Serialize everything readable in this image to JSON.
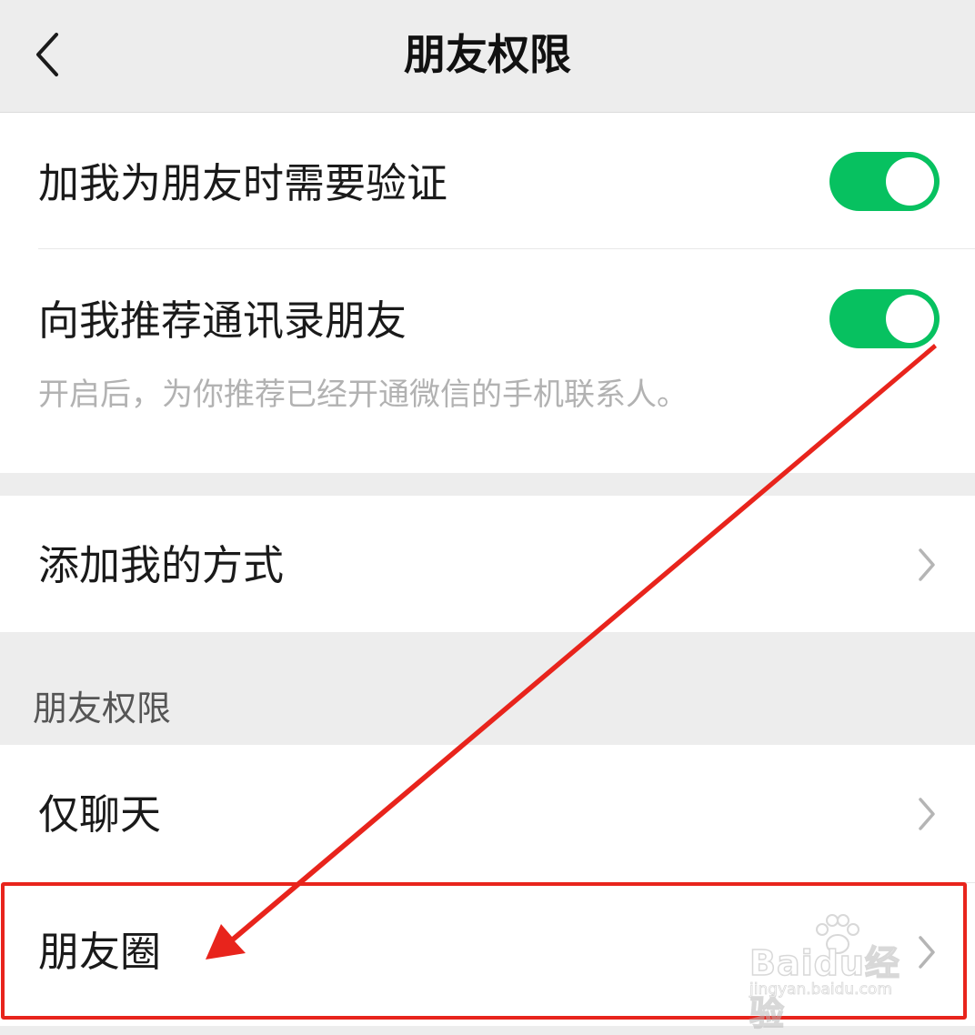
{
  "header": {
    "title": "朋友权限",
    "back_icon": "chevron-left-icon"
  },
  "verification": {
    "label": "加我为朋友时需要验证",
    "toggle_on": true
  },
  "recommend_contacts": {
    "label": "向我推荐通讯录朋友",
    "hint": "开启后，为你推荐已经开通微信的手机联系人。",
    "toggle_on": true
  },
  "add_methods": {
    "label": "添加我的方式"
  },
  "friend_permissions": {
    "section_title": "朋友权限",
    "items": [
      {
        "label": "仅聊天"
      },
      {
        "label": "朋友圈"
      }
    ]
  },
  "watermark": {
    "brand": "Baidu经验",
    "url": "jingyan.baidu.com"
  },
  "colors": {
    "toggle_on": "#07c160",
    "annotation": "#e8241c",
    "background": "#ededed",
    "hint_text": "#b2b2b2"
  }
}
